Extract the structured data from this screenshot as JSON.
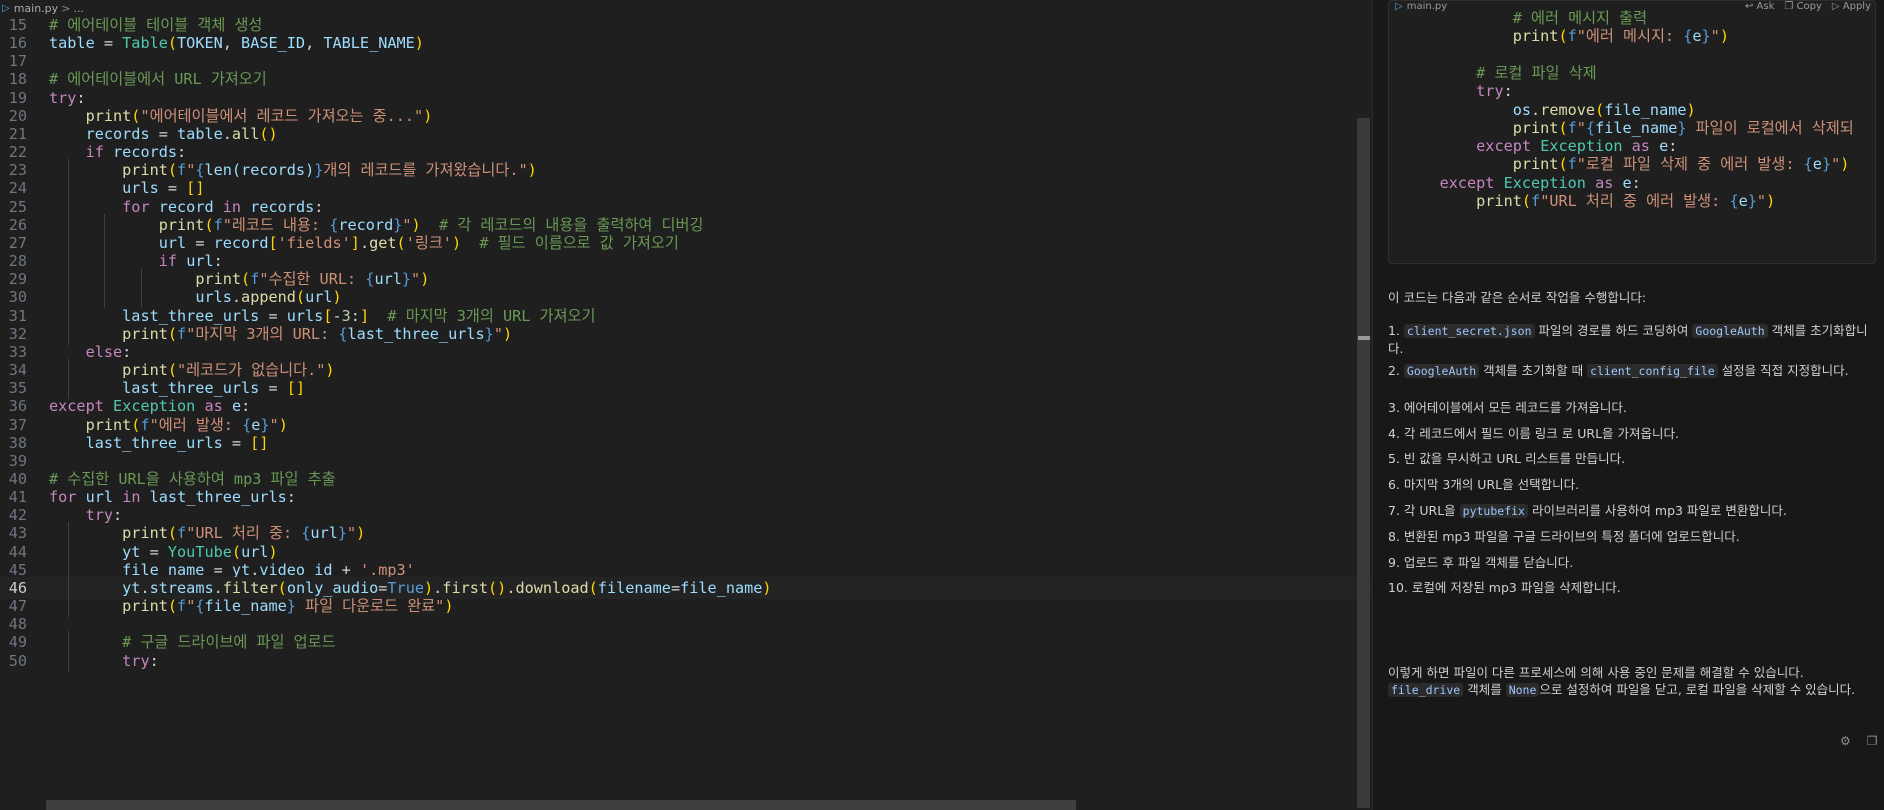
{
  "breadcrumb": {
    "file": "main.py",
    "separator": ">",
    "rest": "..."
  },
  "editor": {
    "current_line": "46",
    "lines": [
      {
        "n": "15",
        "t": "# 에어테이블 테이블 객체 생성"
      },
      {
        "n": "16",
        "t": "table = Table(TOKEN, BASE_ID, TABLE_NAME)"
      },
      {
        "n": "17",
        "t": ""
      },
      {
        "n": "18",
        "t": "# 에어테이블에서 URL 가져오기"
      },
      {
        "n": "19",
        "t": "try:"
      },
      {
        "n": "20",
        "t": "    print(\"에어테이블에서 레코드 가져오는 중...\")"
      },
      {
        "n": "21",
        "t": "    records = table.all()"
      },
      {
        "n": "22",
        "t": "    if records:"
      },
      {
        "n": "23",
        "t": "        print(f\"{len(records)}개의 레코드를 가져왔습니다.\")"
      },
      {
        "n": "24",
        "t": "        urls = []"
      },
      {
        "n": "25",
        "t": "        for record in records:"
      },
      {
        "n": "26",
        "t": "            print(f\"레코드 내용: {record}\")  # 각 레코드의 내용을 출력하여 디버깅"
      },
      {
        "n": "27",
        "t": "            url = record['fields'].get('링크')  # 필드 이름으로 값 가져오기"
      },
      {
        "n": "28",
        "t": "            if url:"
      },
      {
        "n": "29",
        "t": "                print(f\"수집한 URL: {url}\")"
      },
      {
        "n": "30",
        "t": "                urls.append(url)"
      },
      {
        "n": "31",
        "t": "        last_three_urls = urls[-3:]  # 마지막 3개의 URL 가져오기"
      },
      {
        "n": "32",
        "t": "        print(f\"마지막 3개의 URL: {last_three_urls}\")"
      },
      {
        "n": "33",
        "t": "    else:"
      },
      {
        "n": "34",
        "t": "        print(\"레코드가 없습니다.\")"
      },
      {
        "n": "35",
        "t": "        last_three_urls = []"
      },
      {
        "n": "36",
        "t": "except Exception as e:"
      },
      {
        "n": "37",
        "t": "    print(f\"에러 발생: {e}\")"
      },
      {
        "n": "38",
        "t": "    last_three_urls = []"
      },
      {
        "n": "39",
        "t": ""
      },
      {
        "n": "40",
        "t": "# 수집한 URL을 사용하여 mp3 파일 추출"
      },
      {
        "n": "41",
        "t": "for url in last_three_urls:"
      },
      {
        "n": "42",
        "t": "    try:"
      },
      {
        "n": "43",
        "t": "        print(f\"URL 처리 중: {url}\")"
      },
      {
        "n": "44",
        "t": "        yt = YouTube(url)"
      },
      {
        "n": "45",
        "t": "        file_name = yt.video_id + '.mp3'"
      },
      {
        "n": "46",
        "t": "        yt.streams.filter(only_audio=True).first().download(filename=file_name)"
      },
      {
        "n": "47",
        "t": "        print(f\"{file_name} 파일 다운로드 완료\")"
      },
      {
        "n": "48",
        "t": ""
      },
      {
        "n": "49",
        "t": "        # 구글 드라이브에 파일 업로드"
      },
      {
        "n": "50",
        "t": "        try:"
      }
    ]
  },
  "chat": {
    "code_block": {
      "file": "main.py",
      "actions": [
        "Ask",
        "Copy",
        "Apply"
      ],
      "lines": [
        "            # 에러 메시지 출력",
        "            print(f\"에러 메시지: {e}\")",
        "",
        "        # 로컬 파일 삭제",
        "        try:",
        "            os.remove(file_name)",
        "            print(f\"{file_name} 파일이 로컬에서 삭제되",
        "        except Exception as e:",
        "            print(f\"로컬 파일 삭제 중 에러 발생: {e}\")",
        "    except Exception as e:",
        "        print(f\"URL 처리 중 에러 발생: {e}\")"
      ]
    },
    "intro": "이 코드는 다음과 같은 순서로 작업을 수행합니다:",
    "steps": [
      {
        "pre": "1. ",
        "c1": "client_secret.json",
        "mid": " 파일의 경로를 하드 코딩하여 ",
        "c2": "GoogleAuth",
        "post": " 객체를 초기화합니다."
      },
      {
        "pre": "2. ",
        "c1": "GoogleAuth",
        "mid": " 객체를 초기화할 때 ",
        "c2": "client_config_file",
        "post": " 설정을 직접 지정합니다."
      },
      {
        "pre": "3. 에어테이블에서 모든 레코드를 가져옵니다."
      },
      {
        "pre": "4. 각 레코드에서 필드 이름 링크 로 URL을 가져옵니다."
      },
      {
        "pre": "5. 빈 값을 무시하고 URL 리스트를 만듭니다."
      },
      {
        "pre": "6. 마지막 3개의 URL을 선택합니다."
      },
      {
        "pre": "7. 각 URL을 ",
        "c1": "pytubefix",
        "mid": " 라이브러리를 사용하여 mp3 파일로 변환합니다."
      },
      {
        "pre": "8. 변환된 mp3 파일을 구글 드라이브의 특정 폴더에 업로드합니다."
      },
      {
        "pre": "9. 업로드 후 파일 객체를 닫습니다."
      },
      {
        "pre": "10. 로컬에 저장된 mp3 파일을 삭제합니다."
      }
    ],
    "outro": {
      "pre": "이렇게 하면 파일이 다른 프로세스에 의해 사용 중인 문제를 해결할 수 있습니다. ",
      "c1": "file_drive",
      "mid": " 객체를 ",
      "c2": "None",
      "post": "으로 설정하여 파일을 닫고, 로컬 파일을 삭제할 수 있습니다."
    }
  },
  "icons": {
    "bottom": [
      "settings-icon",
      "copy-icon"
    ],
    "header_file": "python-file-icon"
  },
  "colors": {
    "keyword": "#c586c0",
    "builtin": "#569cd6",
    "function": "#dcdcaa",
    "variable": "#9cdcfe",
    "string": "#ce9178",
    "comment": "#6a9955",
    "class": "#4ec9b0",
    "background": "#1f1f1f"
  }
}
